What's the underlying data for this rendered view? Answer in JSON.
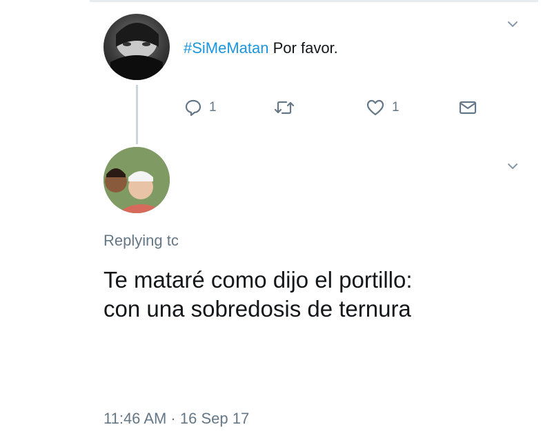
{
  "tweet": {
    "hashtag": "#SiMeMatan",
    "text": " Por favor.",
    "actions": {
      "reply_count": "1",
      "like_count": "1"
    },
    "icons": {
      "reply": "comment-icon",
      "retweet": "retweet-icon",
      "like": "heart-icon",
      "dm": "envelope-icon",
      "menu": "chevron-down-icon"
    }
  },
  "reply": {
    "replying_to": "Replying tc",
    "body_line1": "Te mataré como dijo el portillo:",
    "body_line2": "con una sobredosis de ternura",
    "timestamp": "11:46 AM · 16 Sep 17"
  },
  "colors": {
    "hashtag": "#1b95e0",
    "secondary_text": "#657786",
    "thread_line": "#ccd6dd"
  }
}
